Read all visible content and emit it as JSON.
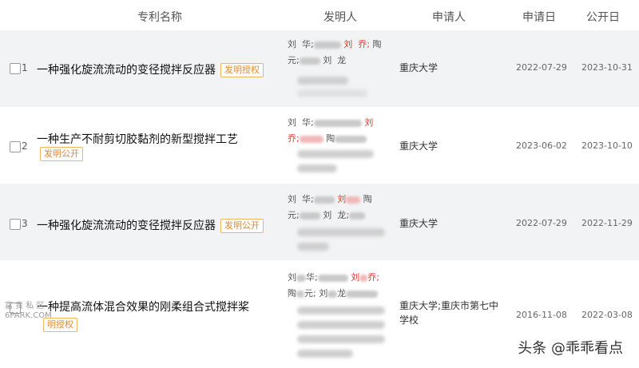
{
  "header": {
    "col_name": "专利名称",
    "col_inventor": "发明人",
    "col_applicant": "申请人",
    "col_apply_date": "申请日",
    "col_publish_date": "公开日"
  },
  "rows": [
    {
      "index": "1",
      "title": "一种强化旋流流动的变径搅拌反应器",
      "badge": "发明授权",
      "inventors": {
        "a": "刘",
        "b": "华;",
        "c": "刘",
        "d": "乔;",
        "e": "陶",
        "f": "元;",
        "g": "刘",
        "h": "龙"
      },
      "applicant": "重庆大学",
      "apply_date": "2022-07-29",
      "publish_date": "2023-10-31"
    },
    {
      "index": "2",
      "title": "一种生产不耐剪切胶黏剂的新型搅拌工艺",
      "badge": "发明公开",
      "inventors": {
        "a": "刘",
        "b": "华;",
        "c": "刘",
        "d": "乔;",
        "e": "陶"
      },
      "applicant": "重庆大学",
      "apply_date": "2023-06-02",
      "publish_date": "2023-10-10"
    },
    {
      "index": "3",
      "title": "一种强化旋流流动的变径搅拌反应器",
      "badge": "发明公开",
      "inventors": {
        "a": "刘",
        "b": "华;",
        "c": "刘",
        "d": "陶",
        "e": "元;",
        "f": "刘",
        "g": "龙;"
      },
      "applicant": "重庆大学",
      "apply_date": "2022-07-29",
      "publish_date": "2022-11-29"
    },
    {
      "index": "4",
      "title": "一种提高流体混合效果的刚柔组合式搅拌桨",
      "badge": "明授权",
      "inventors": {
        "a": "刘",
        "b": "华;",
        "c": "刘",
        "d": "乔;",
        "e": "陶",
        "f": "元;",
        "g": "刘",
        "h": "龙"
      },
      "applicant": "重庆大学;重庆市第七中学校",
      "apply_date": "2016-11-08",
      "publish_date": "2022-03-08"
    }
  ],
  "watermarks": {
    "left_line1": "富 贵 私 区",
    "left_line2": "6PARK.COM",
    "right": "头条 @乖乖看点"
  }
}
